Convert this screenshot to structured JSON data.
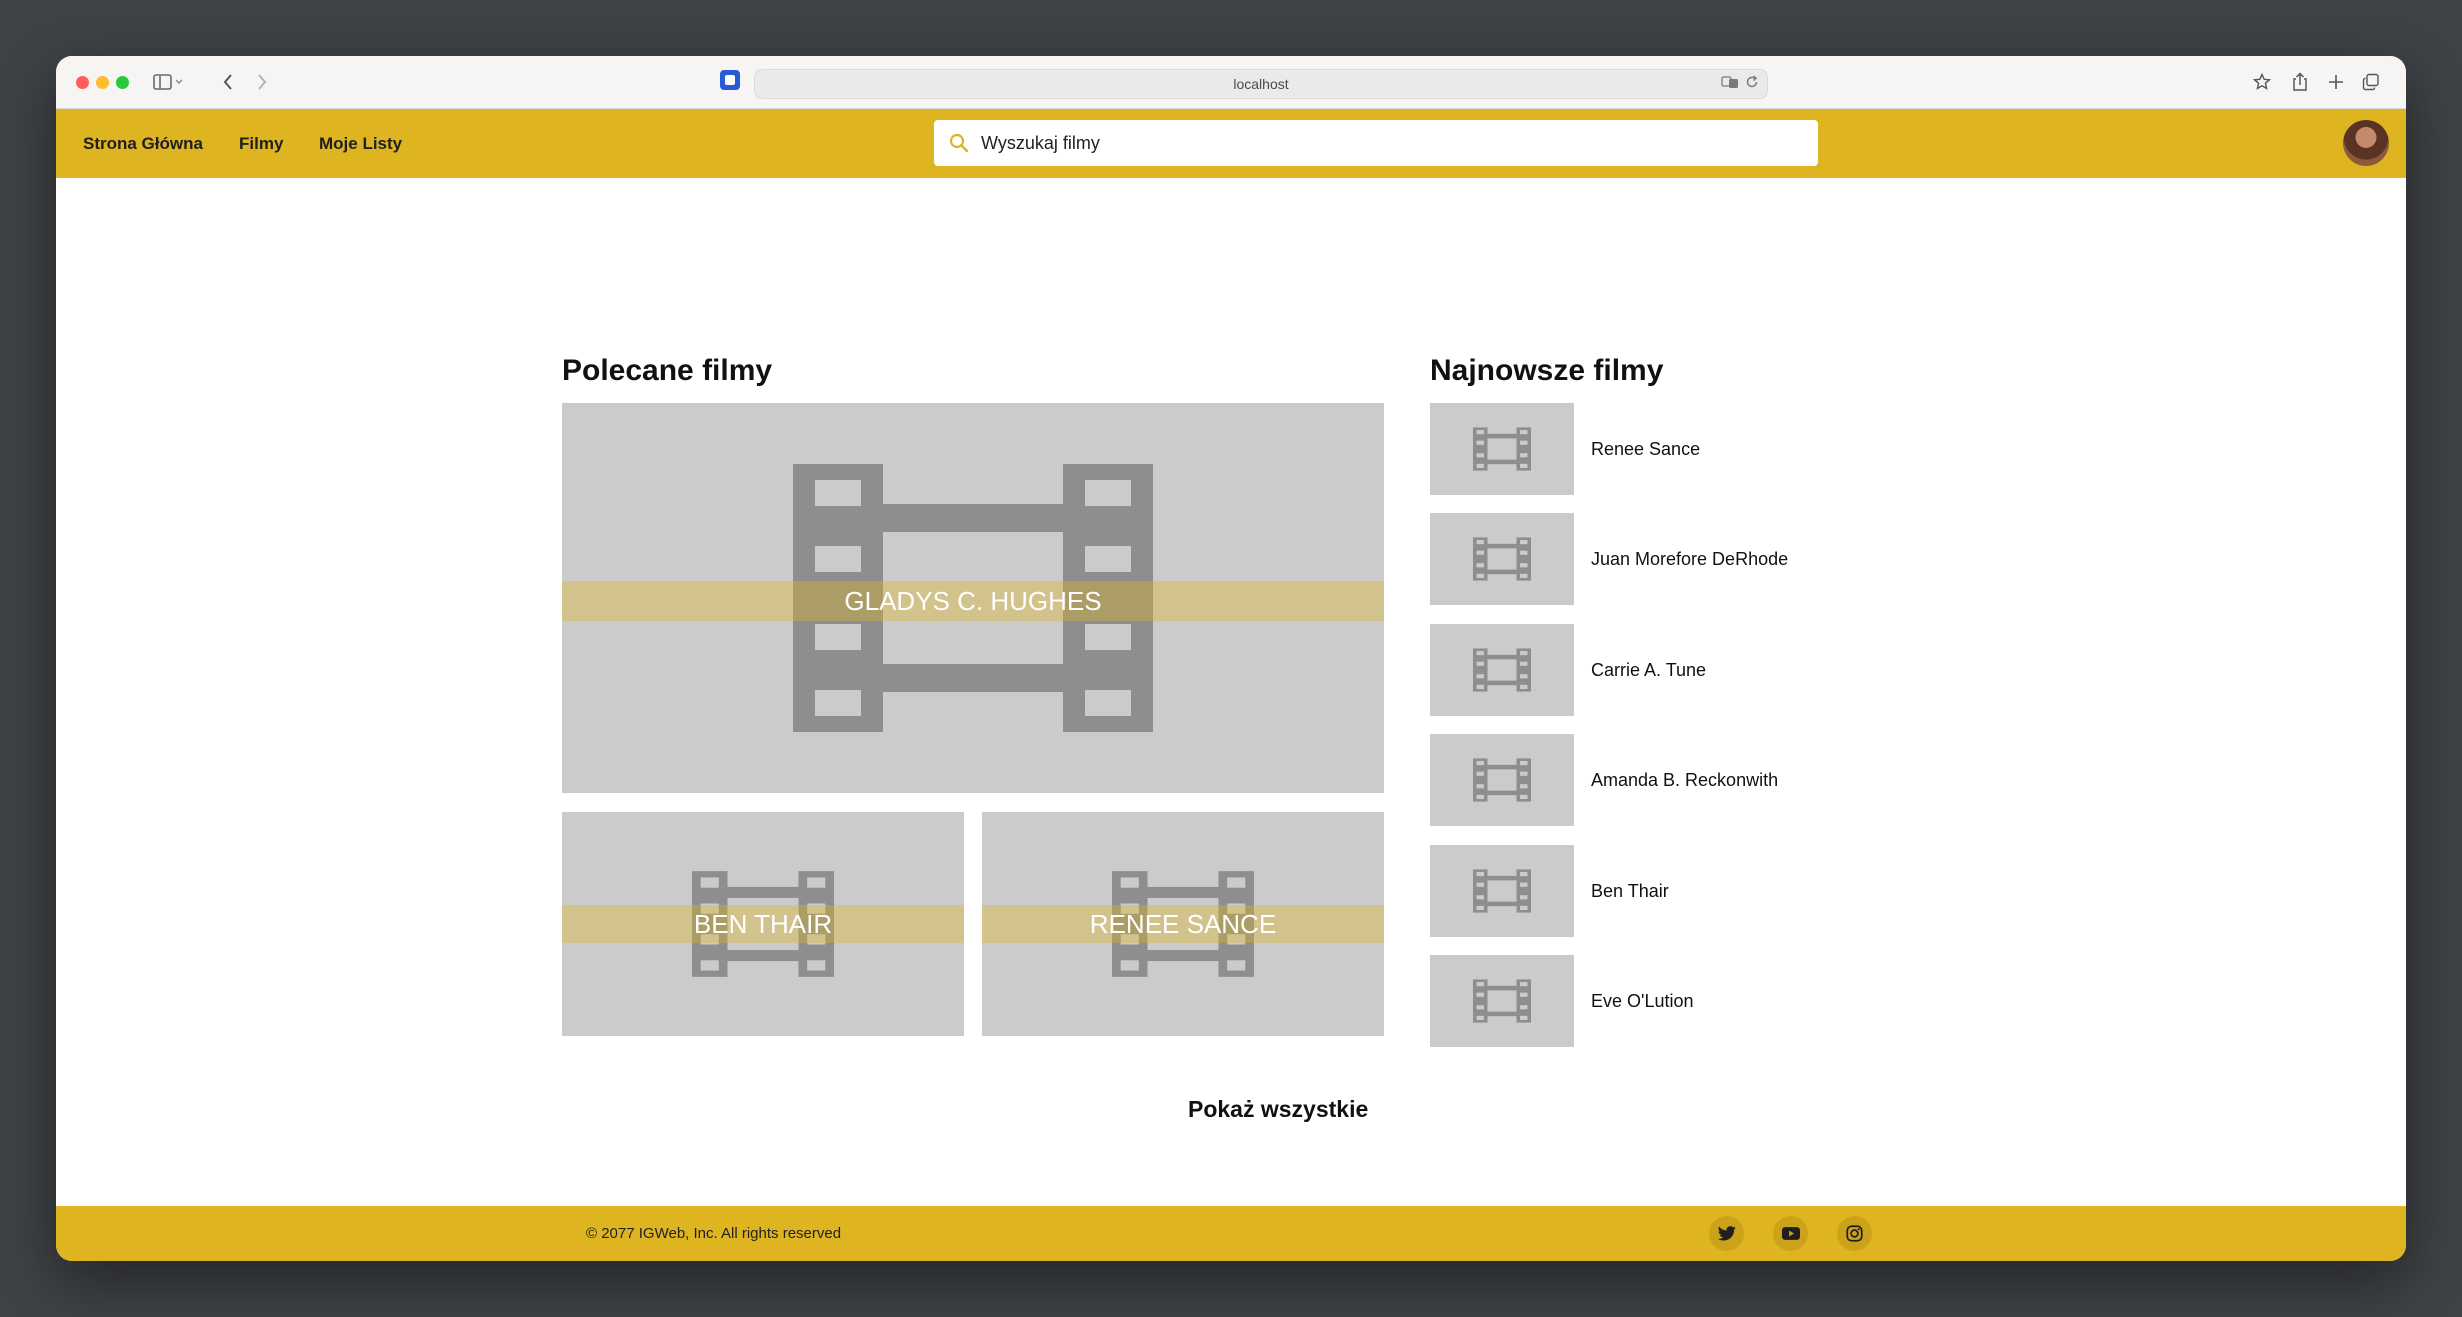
{
  "browser": {
    "url": "localhost"
  },
  "nav": {
    "links": [
      "Strona Główna",
      "Filmy",
      "Moje Listy"
    ],
    "search_placeholder": "Wyszukaj filmy"
  },
  "colors": {
    "brand_yellow": "#deb421",
    "placeholder_gray": "#cbcbcb",
    "film_icon_gray": "#8e8e8e"
  },
  "featured": {
    "heading": "Polecane filmy",
    "main_title": "Gladys C. Hughes",
    "secondary_titles": [
      "Ben Thair",
      "Renee Sance"
    ],
    "show_all_label": "Pokaż wszystkie"
  },
  "newest": {
    "heading": "Najnowsze filmy",
    "items": [
      {
        "title": "Renee Sance"
      },
      {
        "title": "Juan Morefore DeRhode"
      },
      {
        "title": "Carrie A. Tune"
      },
      {
        "title": "Amanda B. Reckonwith"
      },
      {
        "title": "Ben Thair"
      },
      {
        "title": "Eve O'Lution"
      }
    ]
  },
  "footer": {
    "copyright": "© 2077 IGWeb, Inc. All rights reserved",
    "social": [
      "twitter-icon",
      "youtube-icon",
      "instagram-icon"
    ]
  }
}
